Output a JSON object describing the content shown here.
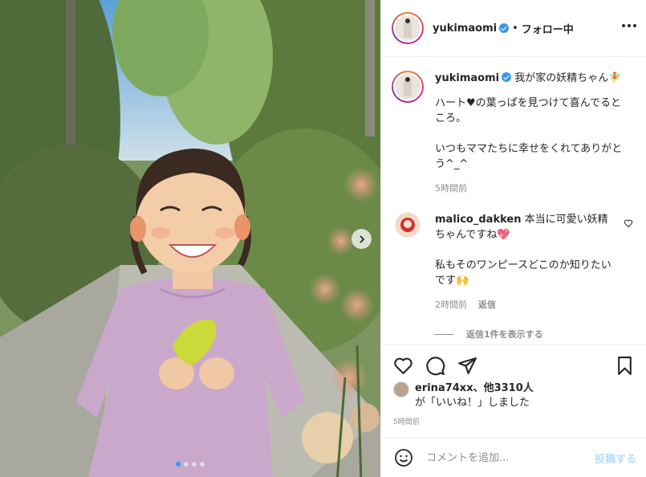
{
  "post": {
    "username": "yukimaomi",
    "follow_status": "フォロー中",
    "separator": "•",
    "caption_lines": [
      "我が家の妖精ちゃん🧚",
      "ハート♥の葉っぱを見つけて喜んでるところ。",
      "いつもママたちに幸せをくれてありがとう^_^"
    ],
    "caption_time": "5時間前"
  },
  "comments": [
    {
      "username": "malico_dakken",
      "text_1": "本当に可愛い妖精ちゃんですね💖",
      "text_2": "私もそのワンピースどこのか知りたいです🙌",
      "time": "2時間前",
      "reply_label": "返信"
    }
  ],
  "view_replies": "返信1件を表示する",
  "likes": {
    "first_user": "erina74xx",
    "others": "、他3310人",
    "suffix": "が「いいね！」しました"
  },
  "post_time": "5時間前",
  "add_comment": {
    "placeholder": "コメントを追加...",
    "post_label": "投稿する"
  },
  "carousel": {
    "total": 4,
    "current": 1
  },
  "colors": {
    "accent": "#3897f0",
    "post_button_disabled": "#b2dffc",
    "muted": "#8e8e8e"
  },
  "icons": [
    "more-icon",
    "verified-icon",
    "heart-icon",
    "comment-icon",
    "share-icon",
    "bookmark-icon",
    "emoji-icon",
    "chevron-right-icon"
  ]
}
